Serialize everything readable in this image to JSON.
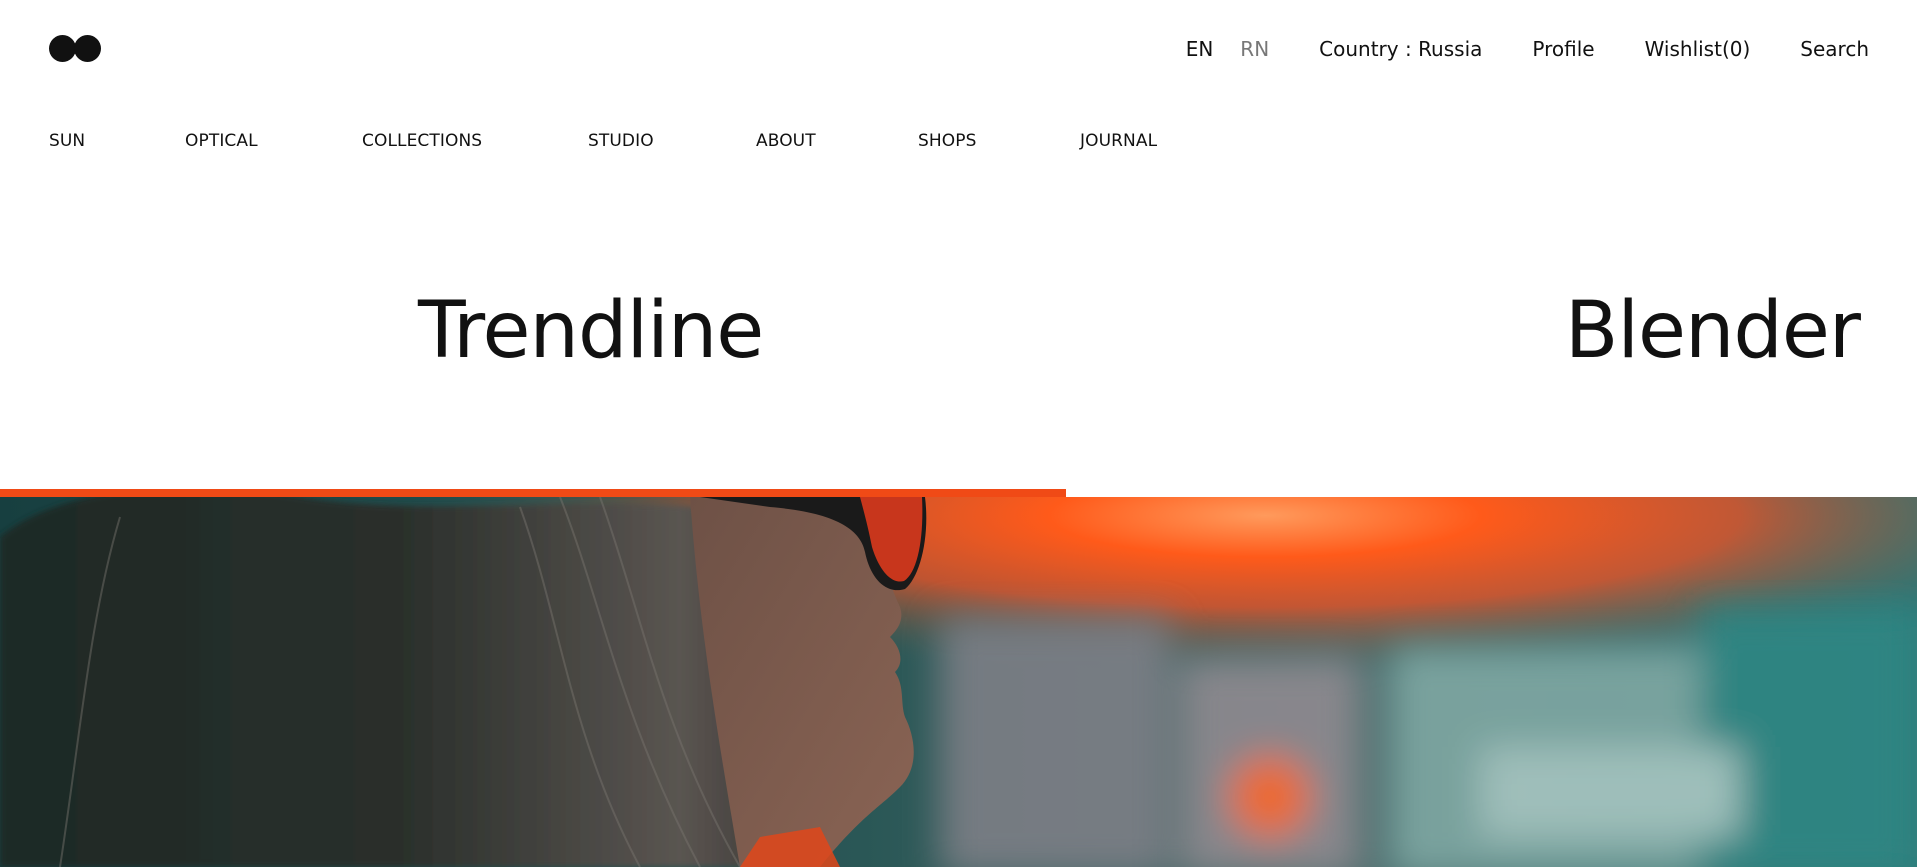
{
  "header": {
    "languages": [
      {
        "label": "EN",
        "active": true
      },
      {
        "label": "RN",
        "active": false
      }
    ],
    "country": "Country : Russia",
    "profile": "Profile",
    "wishlist": "Wishlist(0)",
    "search": "Search"
  },
  "nav": {
    "items": [
      "SUN",
      "OPTICAL",
      "COLLECTIONS",
      "STUDIO",
      "ABOUT",
      "SHOPS",
      "JOURNAL"
    ]
  },
  "hero": {
    "slides": [
      {
        "title": "Trendline"
      },
      {
        "title": "Blender"
      }
    ],
    "progress": 0.556
  },
  "colors": {
    "accent": "#f04a16",
    "text": "#111111",
    "muted": "#777777",
    "background": "#ffffff"
  }
}
